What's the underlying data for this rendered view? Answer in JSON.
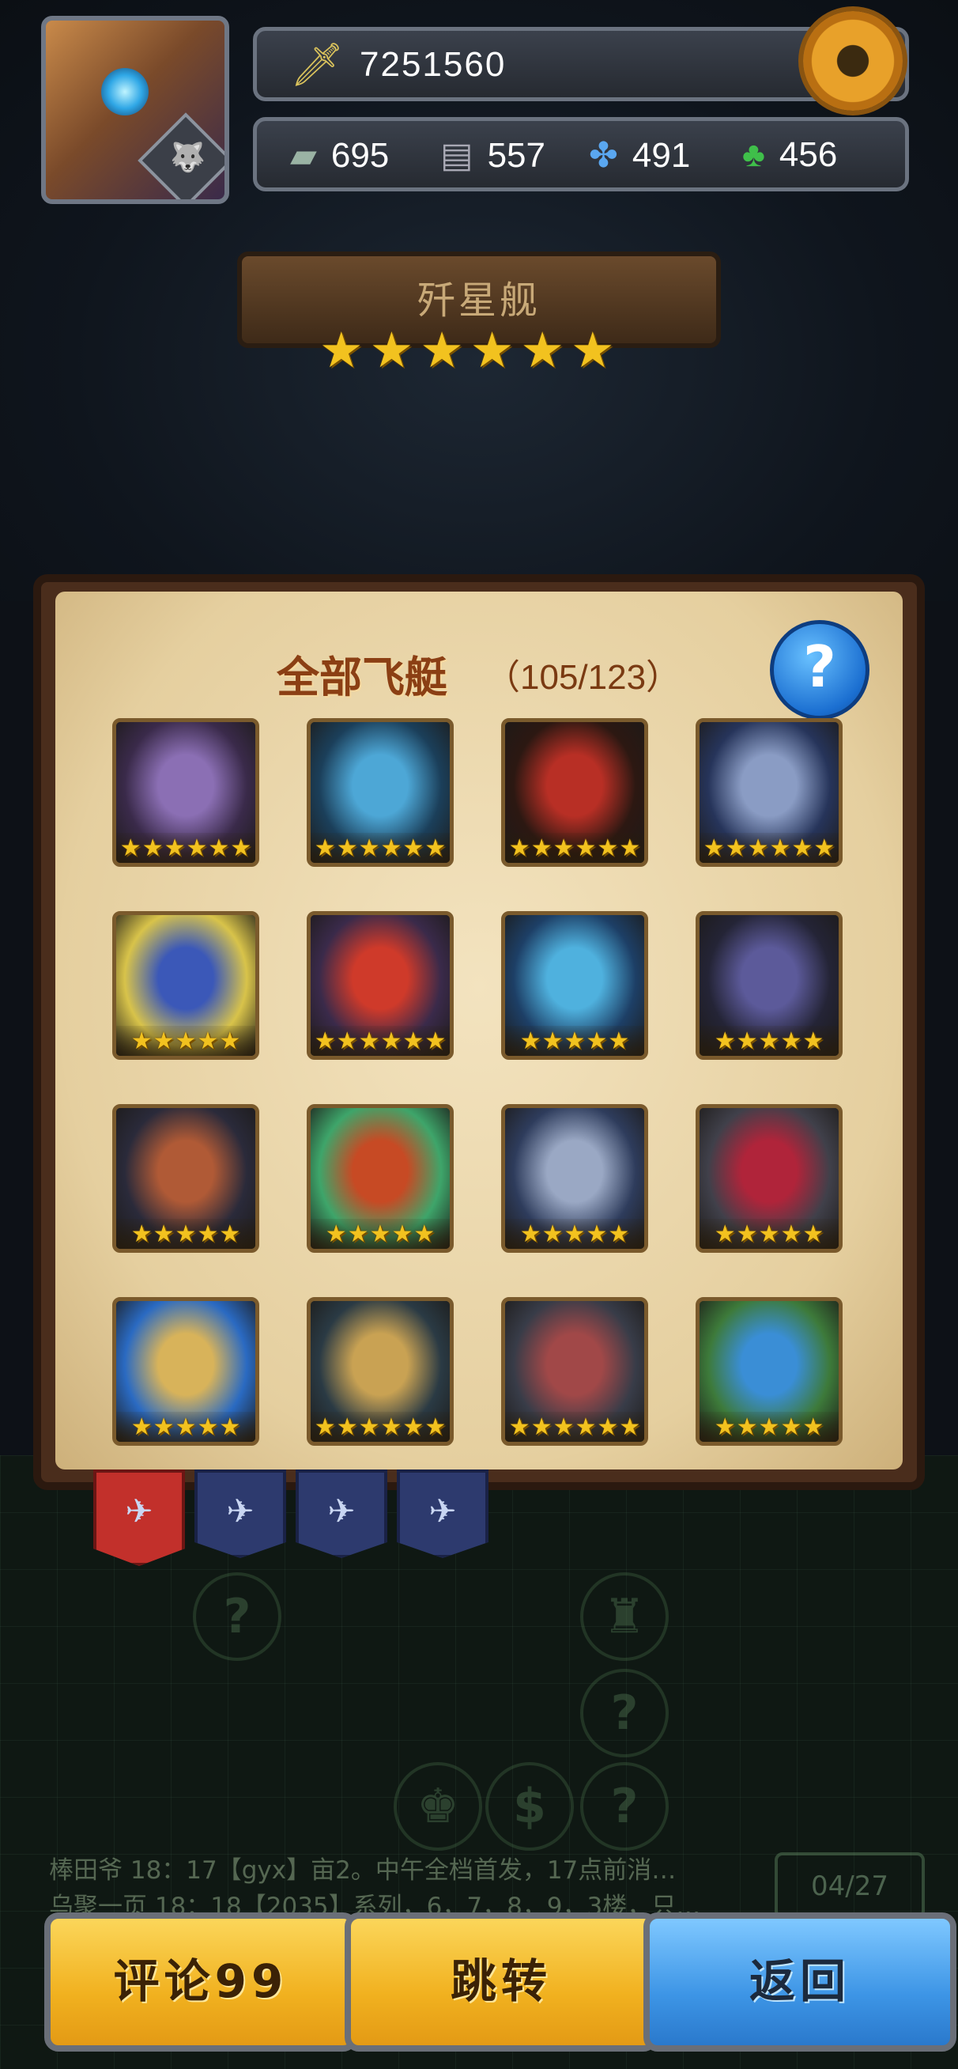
{
  "header": {
    "power": "7251560",
    "resources": [
      {
        "icon": "tank-icon",
        "value": "695"
      },
      {
        "icon": "plate-icon",
        "value": "557"
      },
      {
        "icon": "fan-icon",
        "value": "491"
      },
      {
        "icon": "clover-icon",
        "value": "456"
      }
    ]
  },
  "ship": {
    "name": "歼星舰",
    "stars": 6
  },
  "panel": {
    "title": "全部飞艇",
    "count": "（105/123）"
  },
  "cards": [
    {
      "colors": [
        "#8b6fb4",
        "#3a2a4a"
      ],
      "stars": 6
    },
    {
      "colors": [
        "#4da7d6",
        "#1b3f5a"
      ],
      "stars": 6
    },
    {
      "colors": [
        "#b82f25",
        "#2c1812"
      ],
      "stars": 6
    },
    {
      "colors": [
        "#8a9cc4",
        "#26345a"
      ],
      "stars": 6
    },
    {
      "colors": [
        "#3b58b8",
        "#d8c34a"
      ],
      "stars": 5
    },
    {
      "colors": [
        "#cf3a2a",
        "#3a2a4a"
      ],
      "stars": 6
    },
    {
      "colors": [
        "#4fb1de",
        "#1d3f66"
      ],
      "stars": 5
    },
    {
      "colors": [
        "#5c5a9a",
        "#242436"
      ],
      "stars": 5
    },
    {
      "colors": [
        "#b05a36",
        "#2a2a3a"
      ],
      "stars": 5
    },
    {
      "colors": [
        "#c74a24",
        "#3ea56a"
      ],
      "stars": 5
    },
    {
      "colors": [
        "#9aa8c4",
        "#2e3c5c"
      ],
      "stars": 5
    },
    {
      "colors": [
        "#b0243a",
        "#40404a"
      ],
      "stars": 5
    },
    {
      "colors": [
        "#d8b35a",
        "#2a6ac2"
      ],
      "stars": 5
    },
    {
      "colors": [
        "#c9a253",
        "#2a3a44"
      ],
      "stars": 6
    },
    {
      "colors": [
        "#a14848",
        "#383c48"
      ],
      "stars": 6
    },
    {
      "colors": [
        "#3a8ed6",
        "#3d7a3a"
      ],
      "stars": 5
    }
  ],
  "chat": {
    "line1": "棒田爷 18：17【gyx】亩2。中午全档首发，17点前消…",
    "line2": "乌聚一页 18：18【2035】系列，6，7，8，9，3楼，只…"
  },
  "page_indicator": "04/27",
  "buttons": {
    "comment": "评论99",
    "jump": "跳转",
    "back": "返回"
  }
}
